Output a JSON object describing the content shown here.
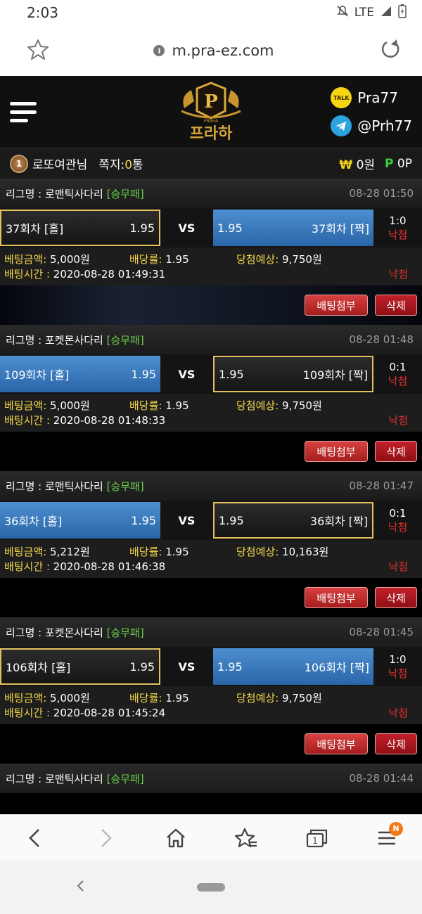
{
  "status": {
    "time": "2:03",
    "network": "LTE"
  },
  "browser": {
    "url": "m.pra-ez.com"
  },
  "header": {
    "brand": "프라하",
    "logo_small": "PRAHA",
    "kakao_label": "TALK",
    "kakao_id": "Pra77",
    "telegram_id": "@Prh77"
  },
  "user": {
    "badge": "1",
    "name": "로또여관",
    "suffix": "님",
    "message_label": "쪽지:",
    "message_count": "0",
    "message_unit": "통",
    "won_symbol": "₩",
    "won_value": "0원",
    "point_symbol": "P",
    "point_value": "0P"
  },
  "labels": {
    "league": "리그명 : ",
    "vs": "VS",
    "amount": "베팅금액: ",
    "odds": "배당률: ",
    "expected": "당첨예상: ",
    "time": "배팅시간 : ",
    "attach": "배팅첨부",
    "delete": "삭제"
  },
  "bets": [
    {
      "league": "로맨틱사다리",
      "tag": "[승무패]",
      "date": "08-28 01:50",
      "home": {
        "name": "37회차 [홀]",
        "odds": "1.95"
      },
      "away": {
        "odds": "1.95",
        "name": "37회차 [짝]"
      },
      "score": "1:0",
      "result": "낙첨",
      "amount": "5,000원",
      "rate": "1.95",
      "expected": "9,750원",
      "bet_time": "2020-08-28 01:49:31",
      "final": "낙첨"
    },
    {
      "league": "포켓몬사다리",
      "tag": "[승무패]",
      "date": "08-28 01:48",
      "home": {
        "name": "109회차 [홀]",
        "odds": "1.95"
      },
      "away": {
        "odds": "1.95",
        "name": "109회차 [짝]"
      },
      "score": "0:1",
      "result": "낙첨",
      "amount": "5,000원",
      "rate": "1.95",
      "expected": "9,750원",
      "bet_time": "2020-08-28 01:48:33",
      "final": "낙첨"
    },
    {
      "league": "로맨틱사다리",
      "tag": "[승무패]",
      "date": "08-28 01:47",
      "home": {
        "name": "36회차 [홀]",
        "odds": "1.95"
      },
      "away": {
        "odds": "1.95",
        "name": "36회차 [짝]"
      },
      "score": "0:1",
      "result": "낙첨",
      "amount": "5,212원",
      "rate": "1.95",
      "expected": "10,163원",
      "bet_time": "2020-08-28 01:46:38",
      "final": "낙첨"
    },
    {
      "league": "포켓몬사다리",
      "tag": "[승무패]",
      "date": "08-28 01:45",
      "home": {
        "name": "106회차 [홀]",
        "odds": "1.95"
      },
      "away": {
        "odds": "1.95",
        "name": "106회차 [짝]"
      },
      "score": "1:0",
      "result": "낙첨",
      "amount": "5,000원",
      "rate": "1.95",
      "expected": "9,750원",
      "bet_time": "2020-08-28 01:45:24",
      "final": "낙첨"
    },
    {
      "league": "로맨틱사다리",
      "tag": "[승무패]",
      "date": "08-28 01:44"
    }
  ],
  "bottom_nav": {
    "notification": "N"
  },
  "colors": {
    "gold": "#e2c060",
    "pick_blue": "#3a7cc0",
    "lose_red": "#e23030",
    "green": "#6ad04a"
  }
}
